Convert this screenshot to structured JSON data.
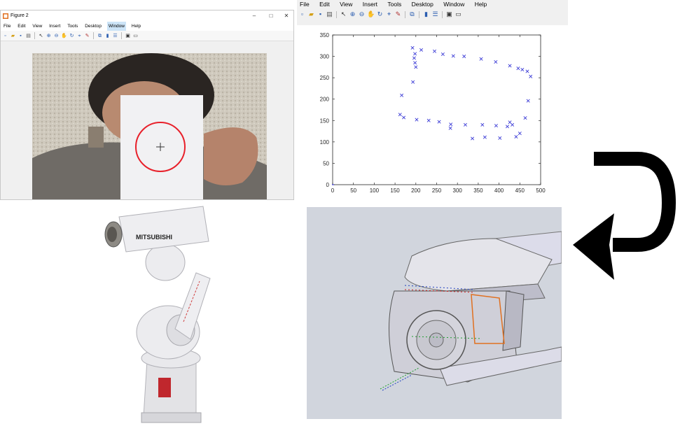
{
  "window1": {
    "title": "Figure 2",
    "controls": {
      "minimize": "–",
      "maximize": "□",
      "close": "✕"
    },
    "menu": [
      "File",
      "Edit",
      "View",
      "Insert",
      "Tools",
      "Desktop",
      "Window",
      "Help"
    ],
    "active_menu": "Window"
  },
  "window2": {
    "menu": [
      "File",
      "Edit",
      "View",
      "Insert",
      "Tools",
      "Desktop",
      "Window",
      "Help"
    ]
  },
  "toolbar_icons": [
    "new-icon",
    "open-icon",
    "save-icon",
    "print-icon",
    "pointer-icon",
    "zoom-in-icon",
    "zoom-out-icon",
    "pan-icon",
    "rotate-icon",
    "data-cursor-icon",
    "brush-icon",
    "link-icon",
    "colorbar-icon",
    "legend-icon",
    "hide-tools-icon",
    "show-tools-icon"
  ],
  "robot": {
    "brand": "MITSUBISHI"
  },
  "colors": {
    "plot_marker": "#3b3bd6",
    "circle": "#e8202a",
    "arrow": "#000000"
  },
  "chart_data": {
    "type": "scatter",
    "title": "",
    "xlabel": "",
    "ylabel": "",
    "xlim": [
      0,
      500
    ],
    "ylim": [
      0,
      350
    ],
    "xticks": [
      0,
      50,
      100,
      150,
      200,
      250,
      300,
      350,
      400,
      450,
      500
    ],
    "yticks": [
      0,
      50,
      100,
      150,
      200,
      250,
      300,
      350
    ],
    "marker": "x",
    "x": [
      192,
      198,
      213,
      245,
      265,
      290,
      316,
      357,
      392,
      426,
      446,
      456,
      468,
      476,
      196,
      198,
      200,
      193,
      166,
      162,
      171,
      202,
      231,
      256,
      284,
      283,
      319,
      336,
      366,
      360,
      393,
      402,
      420,
      426,
      432,
      441,
      450,
      463,
      470
    ],
    "y": [
      320,
      306,
      315,
      312,
      305,
      301,
      300,
      294,
      287,
      278,
      272,
      269,
      265,
      253,
      296,
      285,
      275,
      240,
      209,
      164,
      157,
      152,
      150,
      147,
      141,
      132,
      140,
      108,
      111,
      140,
      138,
      109,
      136,
      146,
      140,
      112,
      120,
      156,
      196
    ]
  }
}
